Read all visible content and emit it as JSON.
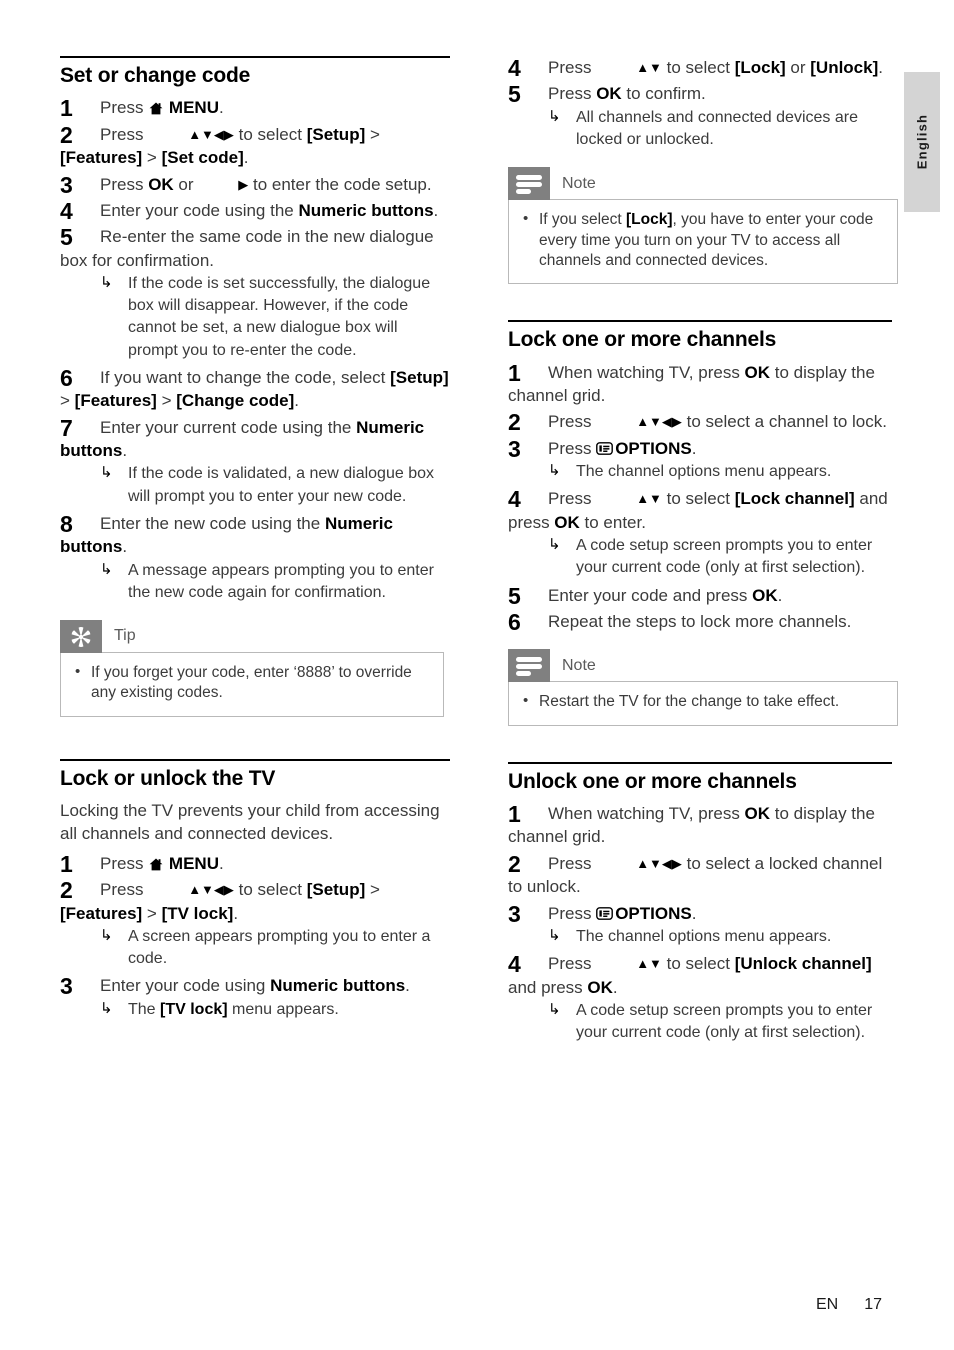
{
  "language_tab": {
    "label": "English"
  },
  "footer": {
    "lang_code": "EN",
    "page_number": "17"
  },
  "glyphs": {
    "home": "home-icon",
    "options": "options-icon",
    "up": "▲",
    "down": "▼",
    "left": "◀",
    "right": "▶",
    "hook": "↳",
    "bullet": "•"
  },
  "colors": {
    "callout_header": "#808080",
    "callout_border": "#b9b9b9",
    "rule": "#000000",
    "body_text": "#3b3b3b",
    "bold_text": "#000000",
    "lang_tab_bg": "#d4d4d4"
  },
  "left_column": {
    "section1": {
      "title": "Set or change code",
      "steps": [
        {
          "num": "1",
          "parts": [
            {
              "t": "text",
              "v": "Press "
            },
            {
              "t": "icon",
              "v": "home"
            },
            {
              "t": "bold",
              "v": " MENU"
            },
            {
              "t": "text",
              "v": "."
            }
          ]
        },
        {
          "num": "2",
          "parts": [
            {
              "t": "text",
              "v": "Press "
            },
            {
              "t": "arrows",
              "v": "▲▼◀▶"
            },
            {
              "t": "text",
              "v": " to select "
            },
            {
              "t": "bold",
              "v": "[Setup]"
            },
            {
              "t": "text",
              "v": " > "
            },
            {
              "t": "bold",
              "v": "[Features]"
            },
            {
              "t": "text",
              "v": " > "
            },
            {
              "t": "bold",
              "v": "[Set code]"
            },
            {
              "t": "text",
              "v": "."
            }
          ]
        },
        {
          "num": "3",
          "parts": [
            {
              "t": "text",
              "v": "Press "
            },
            {
              "t": "bold",
              "v": "OK"
            },
            {
              "t": "text",
              "v": " or "
            },
            {
              "t": "arrows",
              "v": "▶"
            },
            {
              "t": "text",
              "v": " to enter the code setup."
            }
          ]
        },
        {
          "num": "4",
          "parts": [
            {
              "t": "text",
              "v": "Enter your code using the "
            },
            {
              "t": "bold",
              "v": "Numeric buttons"
            },
            {
              "t": "text",
              "v": "."
            }
          ]
        },
        {
          "num": "5",
          "parts": [
            {
              "t": "text",
              "v": "Re-enter the same code in the new dialogue box for confirmation."
            }
          ],
          "sub": [
            "If the code is set successfully, the dialogue box will disappear. However, if the code cannot be set, a new dialogue box will prompt you to re-enter the code."
          ]
        },
        {
          "num": "6",
          "parts": [
            {
              "t": "text",
              "v": "If you want to change the code, select "
            },
            {
              "t": "bold",
              "v": "[Setup]"
            },
            {
              "t": "text",
              "v": " > "
            },
            {
              "t": "bold",
              "v": "[Features]"
            },
            {
              "t": "text",
              "v": " > "
            },
            {
              "t": "bold",
              "v": "[Change code]"
            },
            {
              "t": "text",
              "v": "."
            }
          ]
        },
        {
          "num": "7",
          "parts": [
            {
              "t": "text",
              "v": "Enter your current code using the "
            },
            {
              "t": "bold",
              "v": "Numeric buttons"
            },
            {
              "t": "text",
              "v": "."
            }
          ],
          "sub": [
            "If the code is validated, a new dialogue box will prompt you to enter your new code."
          ]
        },
        {
          "num": "8",
          "parts": [
            {
              "t": "text",
              "v": "Enter the new code using the "
            },
            {
              "t": "bold",
              "v": "Numeric buttons"
            },
            {
              "t": "text",
              "v": "."
            }
          ],
          "sub": [
            "A message appears prompting you to enter the new code again for confirmation."
          ]
        }
      ],
      "tip": {
        "kind": "tip",
        "label": "Tip",
        "items": [
          "If you forget your code, enter ‘8888’ to override any existing codes."
        ]
      }
    },
    "section2": {
      "title": "Lock or unlock the TV",
      "intro": "Locking the TV prevents your child from accessing all channels and connected devices.",
      "steps": [
        {
          "num": "1",
          "parts": [
            {
              "t": "text",
              "v": "Press "
            },
            {
              "t": "icon",
              "v": "home"
            },
            {
              "t": "bold",
              "v": " MENU"
            },
            {
              "t": "text",
              "v": "."
            }
          ]
        },
        {
          "num": "2",
          "parts": [
            {
              "t": "text",
              "v": "Press "
            },
            {
              "t": "arrows",
              "v": "▲▼◀▶"
            },
            {
              "t": "text",
              "v": " to select "
            },
            {
              "t": "bold",
              "v": "[Setup]"
            },
            {
              "t": "text",
              "v": " > "
            },
            {
              "t": "bold",
              "v": "[Features]"
            },
            {
              "t": "text",
              "v": " > "
            },
            {
              "t": "bold",
              "v": "[TV lock]"
            },
            {
              "t": "text",
              "v": "."
            }
          ],
          "sub": [
            "A screen appears prompting you to enter a code."
          ]
        },
        {
          "num": "3",
          "parts": [
            {
              "t": "text",
              "v": "Enter your code using "
            },
            {
              "t": "bold",
              "v": "Numeric buttons"
            },
            {
              "t": "text",
              "v": "."
            }
          ],
          "sub_rich": [
            [
              {
                "t": "text",
                "v": "The "
              },
              {
                "t": "bold",
                "v": "[TV lock]"
              },
              {
                "t": "text",
                "v": " menu appears."
              }
            ]
          ]
        }
      ]
    }
  },
  "right_column": {
    "section0": {
      "steps": [
        {
          "num": "4",
          "parts": [
            {
              "t": "text",
              "v": "Press "
            },
            {
              "t": "arrows",
              "v": "▲▼"
            },
            {
              "t": "text",
              "v": " to select "
            },
            {
              "t": "bold",
              "v": "[Lock]"
            },
            {
              "t": "text",
              "v": " or "
            },
            {
              "t": "bold",
              "v": "[Unlock]"
            },
            {
              "t": "text",
              "v": "."
            }
          ]
        },
        {
          "num": "5",
          "parts": [
            {
              "t": "text",
              "v": "Press "
            },
            {
              "t": "bold",
              "v": "OK"
            },
            {
              "t": "text",
              "v": " to confirm."
            }
          ],
          "sub": [
            "All channels and connected devices are locked or unlocked."
          ]
        }
      ],
      "note": {
        "kind": "note",
        "label": "Note",
        "items_rich": [
          [
            {
              "t": "text",
              "v": "If you select "
            },
            {
              "t": "bold",
              "v": "[Lock]"
            },
            {
              "t": "text",
              "v": ", you have to enter your code every time you turn on your TV to access all channels and connected devices."
            }
          ]
        ]
      }
    },
    "section1": {
      "title": "Lock one or more channels",
      "steps": [
        {
          "num": "1",
          "parts": [
            {
              "t": "text",
              "v": "When watching TV, press "
            },
            {
              "t": "bold",
              "v": "OK"
            },
            {
              "t": "text",
              "v": " to display the channel grid."
            }
          ]
        },
        {
          "num": "2",
          "parts": [
            {
              "t": "text",
              "v": "Press "
            },
            {
              "t": "arrows",
              "v": "▲▼◀▶"
            },
            {
              "t": "text",
              "v": " to select a channel to lock."
            }
          ]
        },
        {
          "num": "3",
          "parts": [
            {
              "t": "text",
              "v": "Press "
            },
            {
              "t": "icon",
              "v": "options"
            },
            {
              "t": "bold",
              "v": "OPTIONS"
            },
            {
              "t": "text",
              "v": "."
            }
          ],
          "sub": [
            "The channel options menu appears."
          ]
        },
        {
          "num": "4",
          "parts": [
            {
              "t": "text",
              "v": "Press "
            },
            {
              "t": "arrows",
              "v": "▲▼"
            },
            {
              "t": "text",
              "v": " to select "
            },
            {
              "t": "bold",
              "v": "[Lock channel]"
            },
            {
              "t": "text",
              "v": " and press "
            },
            {
              "t": "bold",
              "v": "OK"
            },
            {
              "t": "text",
              "v": " to enter."
            }
          ],
          "sub": [
            "A code setup screen prompts you to enter your current code (only at first selection)."
          ]
        },
        {
          "num": "5",
          "parts": [
            {
              "t": "text",
              "v": "Enter your code and press "
            },
            {
              "t": "bold",
              "v": "OK"
            },
            {
              "t": "text",
              "v": "."
            }
          ]
        },
        {
          "num": "6",
          "parts": [
            {
              "t": "text",
              "v": "Repeat the steps to lock more channels."
            }
          ]
        }
      ],
      "note": {
        "kind": "note",
        "label": "Note",
        "items": [
          "Restart the TV for the change to take effect."
        ]
      }
    },
    "section2": {
      "title": "Unlock one or more channels",
      "steps": [
        {
          "num": "1",
          "parts": [
            {
              "t": "text",
              "v": "When watching TV, press "
            },
            {
              "t": "bold",
              "v": "OK"
            },
            {
              "t": "text",
              "v": " to display the channel grid."
            }
          ]
        },
        {
          "num": "2",
          "parts": [
            {
              "t": "text",
              "v": "Press "
            },
            {
              "t": "arrows",
              "v": "▲▼◀▶"
            },
            {
              "t": "text",
              "v": " to select a locked channel to unlock."
            }
          ]
        },
        {
          "num": "3",
          "parts": [
            {
              "t": "text",
              "v": "Press "
            },
            {
              "t": "icon",
              "v": "options"
            },
            {
              "t": "bold",
              "v": "OPTIONS"
            },
            {
              "t": "text",
              "v": "."
            }
          ],
          "sub": [
            "The channel options menu appears."
          ]
        },
        {
          "num": "4",
          "parts": [
            {
              "t": "text",
              "v": "Press "
            },
            {
              "t": "arrows",
              "v": "▲▼"
            },
            {
              "t": "text",
              "v": " to select "
            },
            {
              "t": "bold",
              "v": "[Unlock channel]"
            },
            {
              "t": "text",
              "v": " and press "
            },
            {
              "t": "bold",
              "v": "OK"
            },
            {
              "t": "text",
              "v": "."
            }
          ],
          "sub": [
            "A code setup screen prompts you to enter your current code (only at first selection)."
          ]
        }
      ]
    }
  }
}
